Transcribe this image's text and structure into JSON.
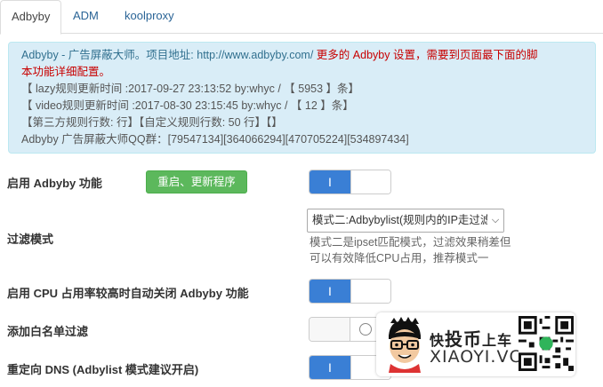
{
  "tabs": [
    {
      "label": "Adbyby",
      "active": true
    },
    {
      "label": "ADM",
      "active": false
    },
    {
      "label": "koolproxy",
      "active": false
    }
  ],
  "info": {
    "line1_blue": "Adbyby - 广告屏蔽大师。项目地址: http://www.adbyby.com/",
    "line1_red": " 更多的 Adbyby 设置，需要到页面最下面的脚",
    "line2_red": "本功能详细配置。",
    "line3": "【 lazy规则更新时间 :2017-09-27 23:13:52 by:whyc / 【 5953 】条】",
    "line4": "【 video规则更新时间 :2017-08-30 23:15:45 by:whyc / 【 12 】条】",
    "line5": "【第三方规则行数: 行】【自定义规则行数: 50 行】【】",
    "line6": "Adbyby 广告屏蔽大师QQ群：[79547134][364066294][470705224][534897434]"
  },
  "settings": {
    "enable_label": "启用 Adbyby 功能",
    "restart_button": "重启、更新程序",
    "enable_on": true,
    "filter_mode_label": "过滤模式",
    "filter_mode_value": "模式二:Adbybylist(规则内的IP走过滤",
    "filter_mode_help": "模式二是ipset匹配模式，过滤效果稍差但可以有效降低CPU占用，推荐模式一",
    "cpu_label": "启用 CPU 占用率较高时自动关闭 Adbyby 功能",
    "cpu_on": true,
    "whitelist_label": "添加白名单过滤",
    "whitelist_on": false,
    "dns_label": "重定向 DNS (Adbylist 模式建议开启)",
    "dns_on": true,
    "toggle_on_mark": "I"
  },
  "watermark": {
    "title_a": "快",
    "title_b": "投币",
    "title_c": "上车",
    "sub": "XIAOYI.VC"
  },
  "colors": {
    "toggle_on": "#3a7fd5",
    "button_green": "#5cb85c",
    "info_bg": "#d9edf7",
    "link_blue": "#2a6496",
    "warn_red": "#c80000"
  }
}
